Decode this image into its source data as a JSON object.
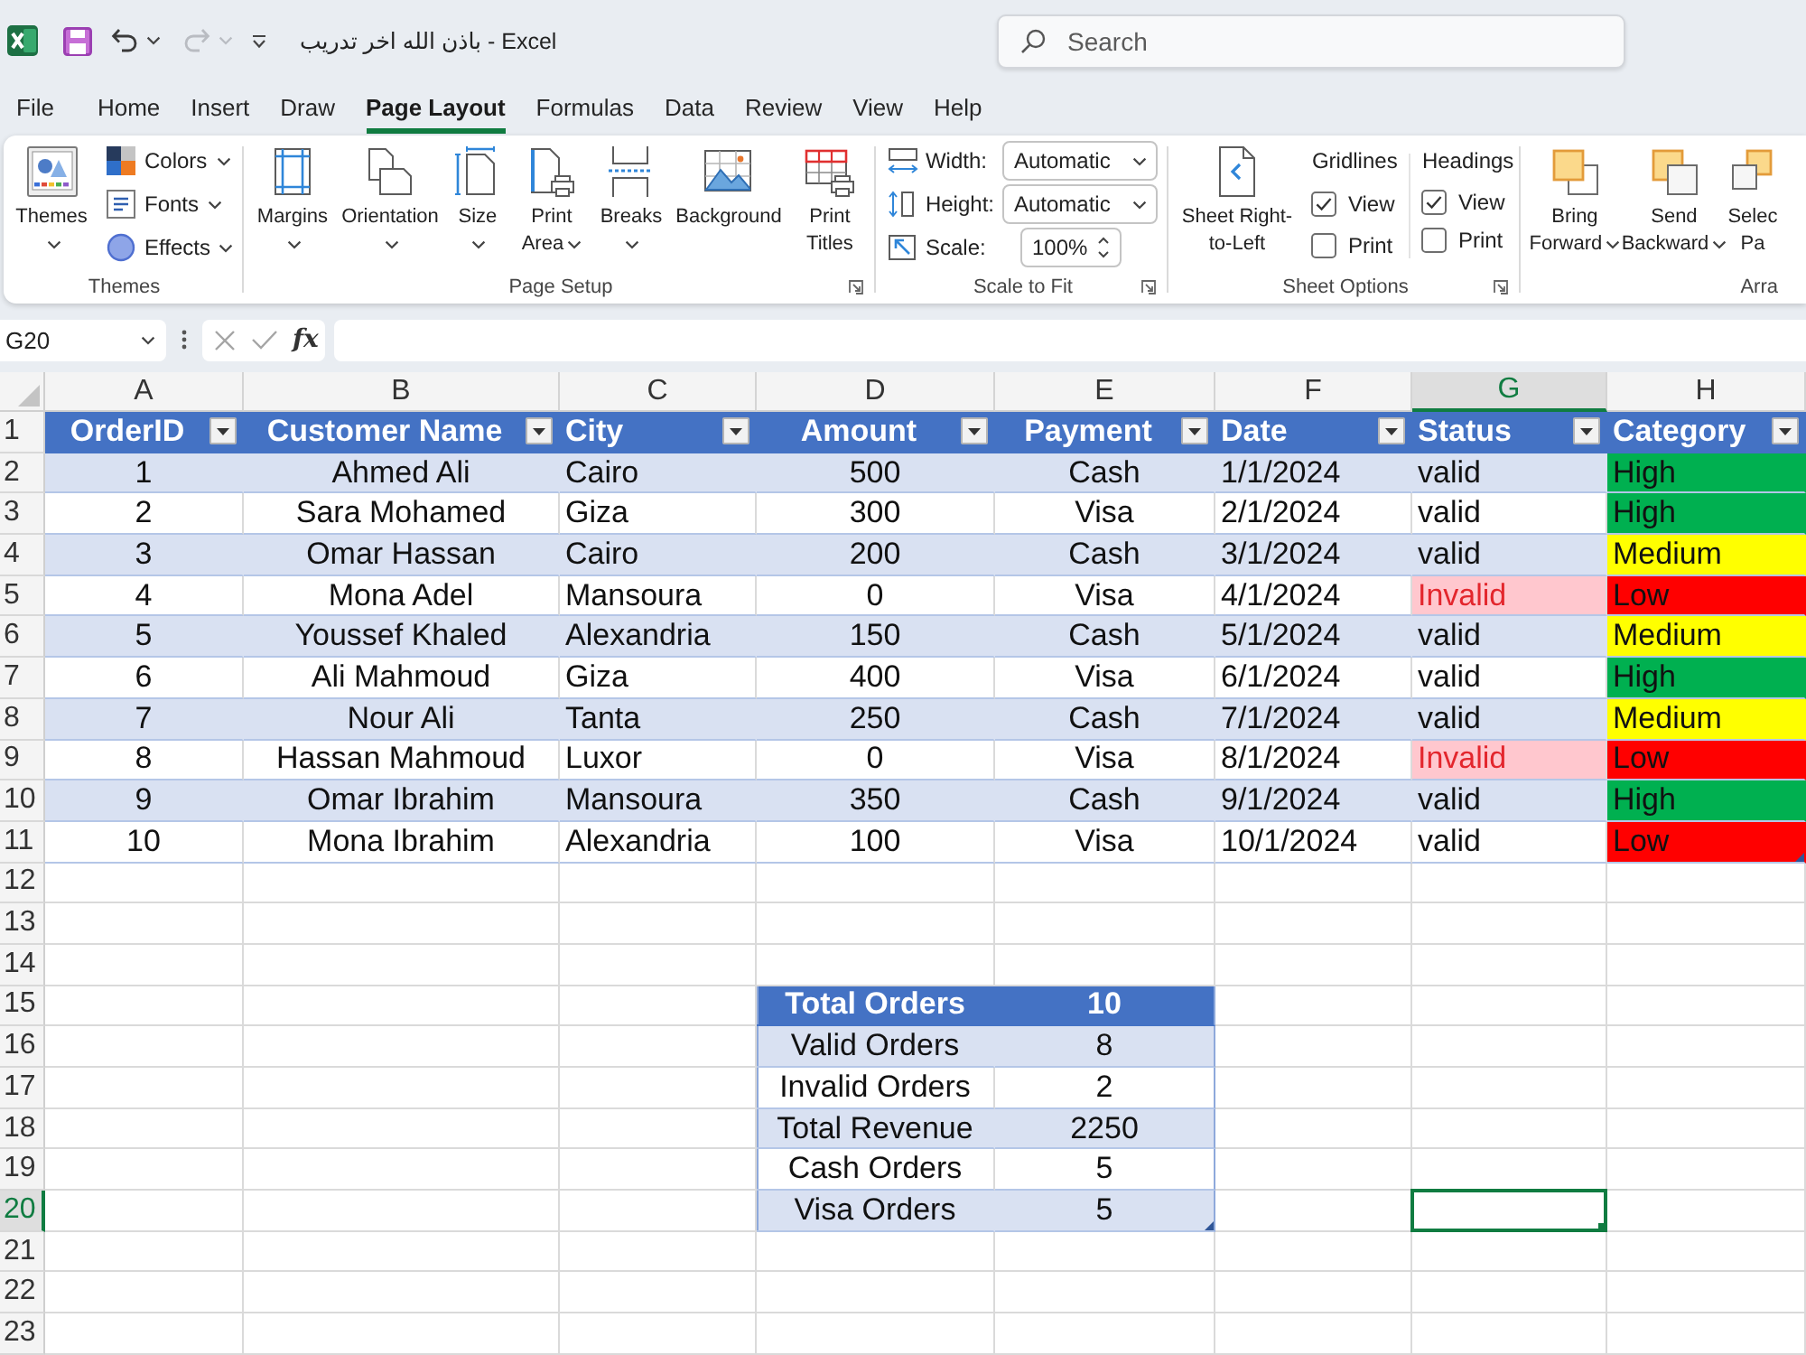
{
  "title_bar": {
    "title": "باذن الله اخر تدريب - Excel",
    "undo": {
      "disabled": false
    },
    "redo": {
      "disabled": true
    },
    "search": {
      "placeholder": "Search"
    }
  },
  "menu_tabs": [
    {
      "label": "File",
      "selected": false
    },
    {
      "label": "Home",
      "selected": false
    },
    {
      "label": "Insert",
      "selected": false
    },
    {
      "label": "Draw",
      "selected": false
    },
    {
      "label": "Page Layout",
      "selected": true
    },
    {
      "label": "Formulas",
      "selected": false
    },
    {
      "label": "Data",
      "selected": false
    },
    {
      "label": "Review",
      "selected": false
    },
    {
      "label": "View",
      "selected": false
    },
    {
      "label": "Help",
      "selected": false
    }
  ],
  "ribbon": {
    "groups": [
      {
        "label": "Themes",
        "launcher": false,
        "items": [
          {
            "kind": "large",
            "label": "Themes",
            "dropdown": true
          },
          {
            "kind": "small",
            "label": "Colors",
            "dropdown": true
          },
          {
            "kind": "small",
            "label": "Fonts",
            "dropdown": true
          },
          {
            "kind": "small",
            "label": "Effects",
            "dropdown": true
          }
        ]
      },
      {
        "label": "Page Setup",
        "launcher": true,
        "items": [
          {
            "kind": "large",
            "label": "Margins",
            "dropdown": true
          },
          {
            "kind": "large",
            "label": "Orientation",
            "dropdown": true
          },
          {
            "kind": "large",
            "label": "Size",
            "dropdown": true
          },
          {
            "kind": "large",
            "label": "Print Area",
            "dropdown": true
          },
          {
            "kind": "large",
            "label": "Breaks",
            "dropdown": true
          },
          {
            "kind": "large",
            "label": "Background",
            "dropdown": false
          },
          {
            "kind": "large",
            "label": "Print Titles",
            "dropdown": false
          }
        ]
      },
      {
        "label": "Scale to Fit",
        "launcher": true,
        "items": [
          {
            "kind": "select",
            "label": "Width:",
            "value": "Automatic"
          },
          {
            "kind": "select",
            "label": "Height:",
            "value": "Automatic"
          },
          {
            "kind": "spinner",
            "label": "Scale:",
            "value": "100%"
          }
        ]
      },
      {
        "label": "Sheet Options",
        "launcher": true,
        "items": [
          {
            "kind": "large",
            "label": "Sheet Right-to-Left",
            "dropdown": false
          },
          {
            "kind": "options",
            "label": "Gridlines",
            "options": [
              {
                "label": "View",
                "checked": true
              },
              {
                "label": "Print",
                "checked": false
              }
            ]
          },
          {
            "kind": "options",
            "label": "Headings",
            "options": [
              {
                "label": "View",
                "checked": true
              },
              {
                "label": "Print",
                "checked": false
              }
            ]
          }
        ]
      },
      {
        "label": "Arra",
        "launcher": false,
        "items": [
          {
            "kind": "large",
            "label": "Bring Forward",
            "dropdown": true
          },
          {
            "kind": "large",
            "label": "Send Backward",
            "dropdown": true
          },
          {
            "kind": "large",
            "label": "Selec Pa",
            "dropdown": false
          }
        ]
      }
    ]
  },
  "formula_bar": {
    "name_box": "G20",
    "function_label": "fx"
  },
  "sheet": {
    "columns": [
      {
        "label": "A",
        "selected": false
      },
      {
        "label": "B",
        "selected": false
      },
      {
        "label": "C",
        "selected": false
      },
      {
        "label": "D",
        "selected": false
      },
      {
        "label": "E",
        "selected": false
      },
      {
        "label": "F",
        "selected": false
      },
      {
        "label": "G",
        "selected": true
      },
      {
        "label": "H",
        "selected": false
      }
    ],
    "rows": [
      {
        "label": "1",
        "selected": false
      },
      {
        "label": "2",
        "selected": false
      },
      {
        "label": "3",
        "selected": false
      },
      {
        "label": "4",
        "selected": false
      },
      {
        "label": "5",
        "selected": false
      },
      {
        "label": "6",
        "selected": false
      },
      {
        "label": "7",
        "selected": false
      },
      {
        "label": "8",
        "selected": false
      },
      {
        "label": "9",
        "selected": false
      },
      {
        "label": "10",
        "selected": false
      },
      {
        "label": "11",
        "selected": false
      },
      {
        "label": "12",
        "selected": false
      },
      {
        "label": "13",
        "selected": false
      },
      {
        "label": "14",
        "selected": false
      },
      {
        "label": "15",
        "selected": false
      },
      {
        "label": "16",
        "selected": false
      },
      {
        "label": "17",
        "selected": false
      },
      {
        "label": "18",
        "selected": false
      },
      {
        "label": "19",
        "selected": false
      },
      {
        "label": "20",
        "selected": true
      },
      {
        "label": "21",
        "selected": false
      },
      {
        "label": "22",
        "selected": false
      },
      {
        "label": "23",
        "selected": false
      }
    ],
    "table": {
      "columns": [
        {
          "label": "OrderID",
          "filter": true
        },
        {
          "label": "Customer Name",
          "filter": true
        },
        {
          "label": "City",
          "filter": true
        },
        {
          "label": "Amount",
          "filter": true
        },
        {
          "label": "Payment",
          "filter": true
        },
        {
          "label": "Date",
          "filter": true
        },
        {
          "label": "Status",
          "filter": true
        },
        {
          "label": "Category",
          "filter": true
        }
      ],
      "rows": [
        {
          "order_id": "1",
          "customer_name": "Ahmed Ali",
          "city": "Cairo",
          "amount": "500",
          "payment": "Cash",
          "date": "1/1/2024",
          "status": {
            "text": "valid",
            "flagged": false
          },
          "category": {
            "text": "High",
            "color": "#00b050"
          }
        },
        {
          "order_id": "2",
          "customer_name": "Sara Mohamed",
          "city": "Giza",
          "amount": "300",
          "payment": "Visa",
          "date": "2/1/2024",
          "status": {
            "text": "valid",
            "flagged": false
          },
          "category": {
            "text": "High",
            "color": "#00b050"
          }
        },
        {
          "order_id": "3",
          "customer_name": "Omar Hassan",
          "city": "Cairo",
          "amount": "200",
          "payment": "Cash",
          "date": "3/1/2024",
          "status": {
            "text": "valid",
            "flagged": false
          },
          "category": {
            "text": "Medium",
            "color": "#ffff00"
          }
        },
        {
          "order_id": "4",
          "customer_name": "Mona Adel",
          "city": "Mansoura",
          "amount": "0",
          "payment": "Visa",
          "date": "4/1/2024",
          "status": {
            "text": "Invalid",
            "flagged": true
          },
          "category": {
            "text": "Low",
            "color": "#ff0000"
          }
        },
        {
          "order_id": "5",
          "customer_name": "Youssef Khaled",
          "city": "Alexandria",
          "amount": "150",
          "payment": "Cash",
          "date": "5/1/2024",
          "status": {
            "text": "valid",
            "flagged": false
          },
          "category": {
            "text": "Medium",
            "color": "#ffff00"
          }
        },
        {
          "order_id": "6",
          "customer_name": "Ali Mahmoud",
          "city": "Giza",
          "amount": "400",
          "payment": "Visa",
          "date": "6/1/2024",
          "status": {
            "text": "valid",
            "flagged": false
          },
          "category": {
            "text": "High",
            "color": "#00b050"
          }
        },
        {
          "order_id": "7",
          "customer_name": "Nour Ali",
          "city": "Tanta",
          "amount": "250",
          "payment": "Cash",
          "date": "7/1/2024",
          "status": {
            "text": "valid",
            "flagged": false
          },
          "category": {
            "text": "Medium",
            "color": "#ffff00"
          }
        },
        {
          "order_id": "8",
          "customer_name": "Hassan Mahmoud",
          "city": "Luxor",
          "amount": "0",
          "payment": "Visa",
          "date": "8/1/2024",
          "status": {
            "text": "Invalid",
            "flagged": true
          },
          "category": {
            "text": "Low",
            "color": "#ff0000"
          }
        },
        {
          "order_id": "9",
          "customer_name": "Omar Ibrahim",
          "city": "Mansoura",
          "amount": "350",
          "payment": "Cash",
          "date": "9/1/2024",
          "status": {
            "text": "valid",
            "flagged": false
          },
          "category": {
            "text": "High",
            "color": "#00b050"
          }
        },
        {
          "order_id": "10",
          "customer_name": "Mona Ibrahim",
          "city": "Alexandria",
          "amount": "100",
          "payment": "Visa",
          "date": "10/1/2024",
          "status": {
            "text": "valid",
            "flagged": false
          },
          "category": {
            "text": "Low",
            "color": "#ff0000"
          }
        }
      ]
    },
    "summary": {
      "rows": [
        {
          "label": "Total Orders",
          "value": "10"
        },
        {
          "label": "Valid Orders",
          "value": "8"
        },
        {
          "label": "Invalid Orders",
          "value": "2"
        },
        {
          "label": "Total Revenue",
          "value": "2250"
        },
        {
          "label": "Cash Orders",
          "value": "5"
        },
        {
          "label": "Visa Orders",
          "value": "5"
        }
      ]
    }
  }
}
